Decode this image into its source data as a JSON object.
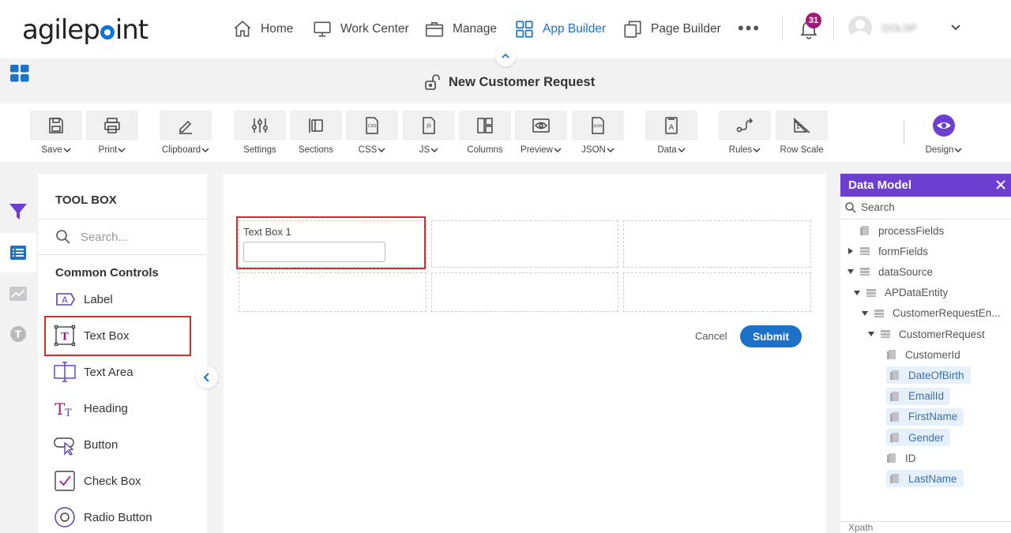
{
  "header": {
    "logo": "agilepoint",
    "nav": [
      {
        "label": "Home",
        "icon": "home-icon"
      },
      {
        "label": "Work Center",
        "icon": "monitor-icon"
      },
      {
        "label": "Manage",
        "icon": "briefcase-icon"
      },
      {
        "label": "App Builder",
        "icon": "grid-icon",
        "active": true
      },
      {
        "label": "Page Builder",
        "icon": "pages-icon"
      }
    ],
    "more": "•••",
    "notification_count": "31",
    "username": "GOLSP"
  },
  "page": {
    "title": "New Customer Request"
  },
  "ribbon": {
    "tools": [
      {
        "label": "Save",
        "icon": "save-icon",
        "dropdown": true
      },
      {
        "label": "Print",
        "icon": "print-icon",
        "dropdown": true
      },
      {
        "label": "Clipboard",
        "icon": "pencil-icon",
        "dropdown": true
      },
      {
        "label": "Settings",
        "icon": "sliders-icon",
        "dropdown": false
      },
      {
        "label": "Sections",
        "icon": "sections-icon",
        "dropdown": false
      },
      {
        "label": "CSS",
        "icon": "css-file-icon",
        "dropdown": true
      },
      {
        "label": "JS",
        "icon": "js-file-icon",
        "dropdown": true
      },
      {
        "label": "Columns",
        "icon": "columns-icon",
        "dropdown": false
      },
      {
        "label": "Preview",
        "icon": "eye-icon",
        "dropdown": true
      },
      {
        "label": "JSON",
        "icon": "json-file-icon",
        "dropdown": true
      },
      {
        "label": "Data",
        "icon": "data-icon",
        "dropdown": true
      },
      {
        "label": "Rules",
        "icon": "rules-icon",
        "dropdown": true
      },
      {
        "label": "Row Scale",
        "icon": "ruler-icon",
        "dropdown": false
      },
      {
        "label": "Design",
        "icon": "design-eye-icon",
        "dropdown": true
      }
    ]
  },
  "toolbox": {
    "title": "TOOL BOX",
    "search_placeholder": "Search...",
    "section": "Common Controls",
    "controls": [
      {
        "label": "Label",
        "icon": "label-icon"
      },
      {
        "label": "Text Box",
        "icon": "textbox-icon",
        "highlighted": true
      },
      {
        "label": "Text Area",
        "icon": "textarea-icon"
      },
      {
        "label": "Heading",
        "icon": "heading-icon"
      },
      {
        "label": "Button",
        "icon": "button-icon"
      },
      {
        "label": "Check Box",
        "icon": "checkbox-icon"
      },
      {
        "label": "Radio Button",
        "icon": "radio-icon"
      }
    ]
  },
  "canvas": {
    "textbox_label": "Text Box 1",
    "textbox_value": "",
    "cancel_label": "Cancel",
    "submit_label": "Submit"
  },
  "data_model": {
    "title": "Data Model",
    "search_placeholder": "Search",
    "nodes": [
      {
        "label": "processFields",
        "depth": 0,
        "arrow": "none",
        "selected": false
      },
      {
        "label": "formFields",
        "depth": 0,
        "arrow": "right",
        "selected": false
      },
      {
        "label": "dataSource",
        "depth": 0,
        "arrow": "down",
        "selected": false
      },
      {
        "label": "APDataEntity",
        "depth": 1,
        "arrow": "down",
        "selected": false
      },
      {
        "label": "CustomerRequestEn...",
        "depth": 2,
        "arrow": "down",
        "selected": false
      },
      {
        "label": "CustomerRequest",
        "depth": 3,
        "arrow": "down",
        "selected": false
      },
      {
        "label": "CustomerId",
        "depth": 4,
        "arrow": "none",
        "selected": false
      },
      {
        "label": "DateOfBirth",
        "depth": 4,
        "arrow": "none",
        "selected": true
      },
      {
        "label": "EmailId",
        "depth": 4,
        "arrow": "none",
        "selected": true
      },
      {
        "label": "FirstName",
        "depth": 4,
        "arrow": "none",
        "selected": true
      },
      {
        "label": "Gender",
        "depth": 4,
        "arrow": "none",
        "selected": true
      },
      {
        "label": "ID",
        "depth": 4,
        "arrow": "none",
        "selected": false
      },
      {
        "label": "LastName",
        "depth": 4,
        "arrow": "none",
        "selected": true
      }
    ],
    "footer": "Xpath"
  },
  "colors": {
    "accent_blue": "#1c72c9",
    "nav_active": "#1a73c8",
    "data_model_header": "#6c3fd1",
    "badge": "#a3197b",
    "highlight_border": "#d42b2b",
    "toolbox_icon": "#7a2a8c"
  }
}
